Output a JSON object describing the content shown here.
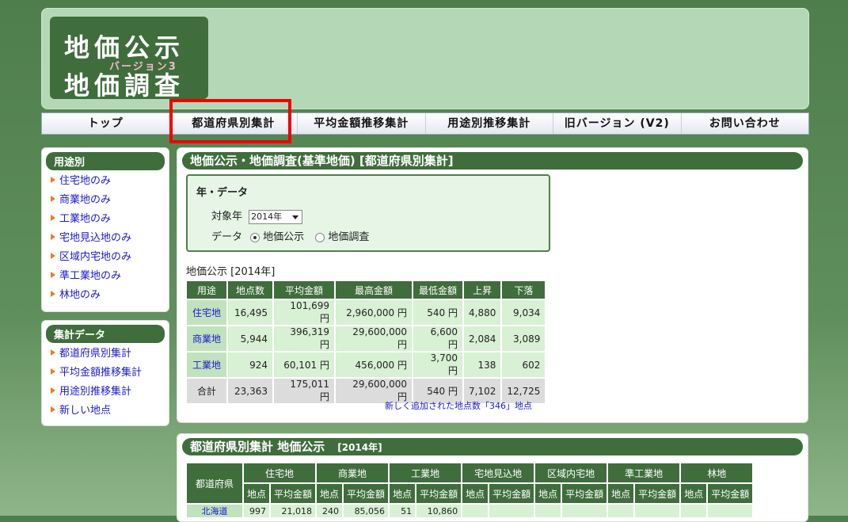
{
  "logo": {
    "line1": "地価公示",
    "version": "バージョン3",
    "line2": "地価調査"
  },
  "nav": [
    "トップ",
    "都道府県別集計",
    "平均金額推移集計",
    "用途別推移集計",
    "旧バージョン (V2)",
    "お問い合わせ"
  ],
  "sidebar": {
    "group1": {
      "title": "用途別",
      "items": [
        "住宅地のみ",
        "商業地のみ",
        "工業地のみ",
        "宅地見込地のみ",
        "区域内宅地のみ",
        "準工業地のみ",
        "林地のみ"
      ]
    },
    "group2": {
      "title": "集計データ",
      "items": [
        "都道府県別集計",
        "平均金額推移集計",
        "用途別推移集計",
        "新しい地点"
      ]
    }
  },
  "main": {
    "title": "地価公示・地価調査(基準地価) [都道府県別集計]",
    "filter": {
      "title": "年・データ",
      "year_label": "対象年",
      "year_value": "2014年",
      "data_label": "データ",
      "option1": "地価公示",
      "option2": "地価調査"
    },
    "caption": "地価公示 [2014年]",
    "table": {
      "headers": [
        "用途",
        "地点数",
        "平均金額",
        "最高金額",
        "最低金額",
        "上昇",
        "下落"
      ],
      "rows": [
        [
          "住宅地",
          "16,495",
          "101,699 円",
          "2,960,000 円",
          "540 円",
          "4,880",
          "9,034"
        ],
        [
          "商業地",
          "5,944",
          "396,319 円",
          "29,600,000 円",
          "6,600 円",
          "2,084",
          "3,089"
        ],
        [
          "工業地",
          "924",
          "60,101 円",
          "456,000 円",
          "3,700 円",
          "138",
          "602"
        ],
        [
          "合計",
          "23,363",
          "175,011 円",
          "29,600,000 円",
          "540 円",
          "7,102",
          "12,725"
        ]
      ]
    },
    "new_points": "新しく追加された地点数「346」地点"
  },
  "section2": {
    "title": "都道府県別集計 地価公示",
    "year": "[2014年]",
    "pref_header": "都道府県",
    "groups": [
      "住宅地",
      "商業地",
      "工業地",
      "宅地見込地",
      "区域内宅地",
      "準工業地",
      "林地"
    ],
    "sub_points": "地点",
    "sub_avg": "平均金額",
    "first_row": {
      "pref": "北海道",
      "cells": [
        "997",
        "21,018",
        "240",
        "85,056",
        "51",
        "10,860",
        "",
        "",
        "",
        "",
        "",
        ""
      ]
    }
  }
}
